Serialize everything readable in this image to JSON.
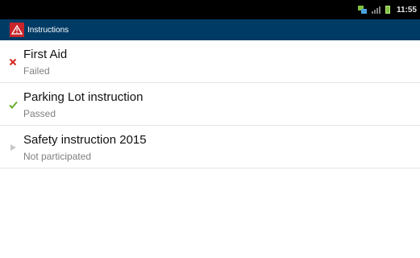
{
  "status_bar": {
    "time": "11:55"
  },
  "action_bar": {
    "title": "Instructions",
    "logo_icon": "warning-triangle-icon"
  },
  "instructions": [
    {
      "title": "First Aid",
      "status": "Failed",
      "icon": "cross-icon",
      "icon_color": "#d62a21"
    },
    {
      "title": "Parking Lot instruction",
      "status": "Passed",
      "icon": "check-icon",
      "icon_color": "#6aae2e"
    },
    {
      "title": "Safety instruction 2015",
      "status": "Not participated",
      "icon": "play-arrow-icon",
      "icon_color": "#c8c8c8"
    }
  ],
  "colors": {
    "action_bar": "#003b66",
    "status_bar": "#000000",
    "logo": "#c9252b"
  }
}
